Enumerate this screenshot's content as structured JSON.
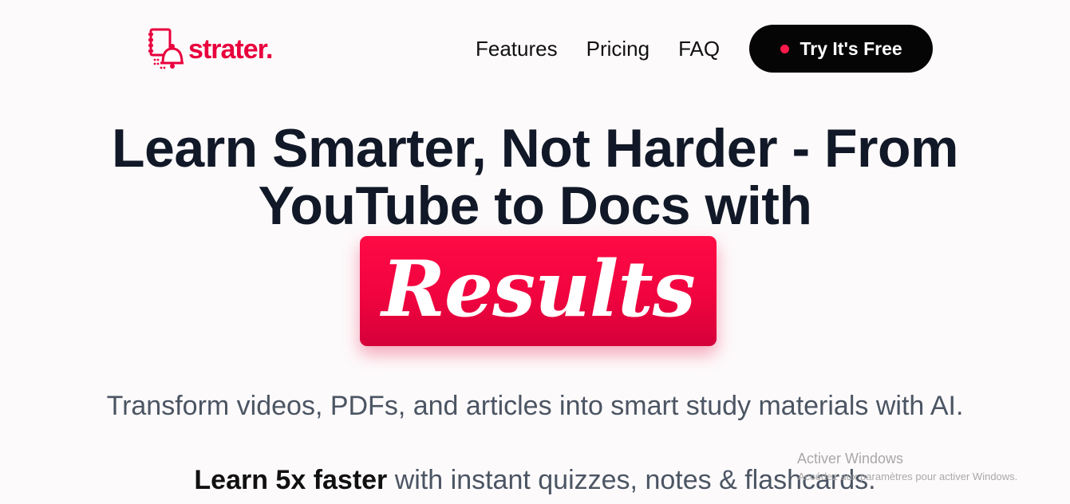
{
  "header": {
    "logo_text": "strater.",
    "nav": [
      {
        "label": "Features"
      },
      {
        "label": "Pricing"
      },
      {
        "label": "FAQ"
      }
    ],
    "cta_label": "Try It's Free"
  },
  "hero": {
    "line1_before": "Learn ",
    "line1_bold": "Smarter",
    "line1_after": ", Not Harder - From",
    "line2": "YouTube to Docs with",
    "highlight": "Results",
    "subtitle": "Transform videos, PDFs, and articles into smart study materials with AI.",
    "subtitle2_bold": "Learn 5x faster",
    "subtitle2_rest": " with instant quizzes, notes & flashcards."
  },
  "watermark": {
    "title": "Activer Windows",
    "subtitle": "Accédez aux paramètres pour activer Windows."
  },
  "colors": {
    "brand": "#e8003d",
    "cta_bg": "#050505",
    "highlight_bg": "#f0043f"
  }
}
